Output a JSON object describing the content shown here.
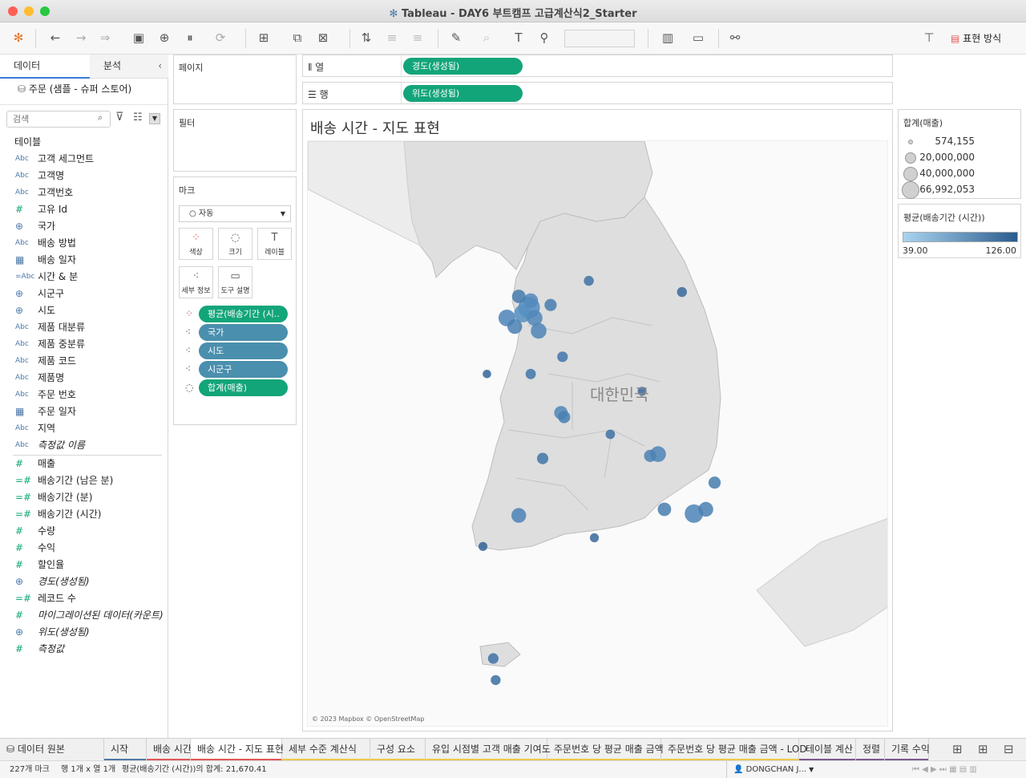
{
  "window": {
    "title": "Tableau - DAY6 부트캠프 고급계산식2_Starter"
  },
  "left_panel": {
    "tab_data": "데이터",
    "tab_analysis": "분석",
    "datasource": "주문 (샘플 - 슈퍼 스토어)",
    "search_placeholder": "검색",
    "tables_header": "테이블",
    "dimensions": [
      {
        "type": "Abc",
        "label": "고객 세그먼트"
      },
      {
        "type": "Abc",
        "label": "고객명"
      },
      {
        "type": "Abc",
        "label": "고객번호"
      },
      {
        "type": "#",
        "label": "고유 Id"
      },
      {
        "type": "geo",
        "label": "국가"
      },
      {
        "type": "Abc",
        "label": "배송 방법"
      },
      {
        "type": "date",
        "label": "배송 일자"
      },
      {
        "type": "=Abc",
        "label": "시간 & 분"
      },
      {
        "type": "geo",
        "label": "시군구"
      },
      {
        "type": "geo",
        "label": "시도"
      },
      {
        "type": "Abc",
        "label": "제품 대분류"
      },
      {
        "type": "Abc",
        "label": "제품 중분류"
      },
      {
        "type": "Abc",
        "label": "제품 코드"
      },
      {
        "type": "Abc",
        "label": "제품명"
      },
      {
        "type": "Abc",
        "label": "주문 번호"
      },
      {
        "type": "date",
        "label": "주문 일자"
      },
      {
        "type": "Abc",
        "label": "지역"
      },
      {
        "type": "Abc",
        "label": "측정값 이름",
        "italic": true
      }
    ],
    "measures": [
      {
        "type": "#",
        "label": "매출"
      },
      {
        "type": "=#",
        "label": "배송기간 (남은 분)"
      },
      {
        "type": "=#",
        "label": "배송기간 (분)"
      },
      {
        "type": "=#",
        "label": "배송기간 (시간)"
      },
      {
        "type": "#",
        "label": "수량"
      },
      {
        "type": "#",
        "label": "수익"
      },
      {
        "type": "#",
        "label": "할인율"
      },
      {
        "type": "geo",
        "label": "경도(생성됨)",
        "italic": true
      },
      {
        "type": "=#",
        "label": "레코드 수"
      },
      {
        "type": "#",
        "label": "마이그레이션된 데이터(카운트)",
        "italic": true
      },
      {
        "type": "geo",
        "label": "위도(생성됨)",
        "italic": true
      },
      {
        "type": "#",
        "label": "측정값",
        "italic": true
      }
    ]
  },
  "shelves": {
    "pages_label": "페이지",
    "filters_label": "필터",
    "marks_label": "마크",
    "mark_type": "자동",
    "mark_buttons": [
      "색상",
      "크기",
      "레이블",
      "세부 정보",
      "도구 설명"
    ],
    "mark_pills": [
      {
        "icon": "color",
        "label": "평균(배송기간 (시..",
        "color": "green"
      },
      {
        "icon": "detail",
        "label": "국가",
        "color": "blue"
      },
      {
        "icon": "detail",
        "label": "시도",
        "color": "blue"
      },
      {
        "icon": "detail",
        "label": "시군구",
        "color": "blue"
      },
      {
        "icon": "size",
        "label": "합계(매출)",
        "color": "green"
      }
    ],
    "columns_label": "열",
    "rows_label": "행",
    "columns_pill": "경도(생성됨)",
    "rows_pill": "위도(생성됨)"
  },
  "toolbar": {
    "show_me_label": "표현 방식"
  },
  "view": {
    "title": "배송 시간 - 지도 표현",
    "map_label": "대한민국",
    "attribution": "© 2023 Mapbox © OpenStreetMap"
  },
  "legends": {
    "size_title": "합계(매출)",
    "size_items": [
      "574,155",
      "20,000,000",
      "40,000,000",
      "66,992,053"
    ],
    "color_title": "평균(배송기간 (시간))",
    "color_min": "39.00",
    "color_max": "126.00",
    "color_low": "#a9d4ef",
    "color_high": "#2b5c8f"
  },
  "tabs": {
    "datasource_tab": "데이터 원본",
    "sheets": [
      {
        "label": "시작",
        "color": "#4e79a7"
      },
      {
        "label": "배송 시간",
        "color": "#e15759"
      },
      {
        "label": "배송 시간 - 지도 표현",
        "color": "#e15759",
        "active": true
      },
      {
        "label": "세부 수준 계산식",
        "color": "#edc948"
      },
      {
        "label": "구성 요소",
        "color": "#edc948"
      },
      {
        "label": "유입 시점별 고객 매출 기여도",
        "color": "#edc948"
      },
      {
        "label": "주문번호 당 평균 매출 금액",
        "color": "#edc948"
      },
      {
        "label": "주문번호 당 평균 매출 금액 - LOD",
        "color": "#edc948"
      },
      {
        "label": "테이블 계산",
        "color": "#7b5a8e"
      },
      {
        "label": "정렬",
        "color": "#7b5a8e"
      },
      {
        "label": "기록 수익",
        "color": "#7b5a8e"
      }
    ]
  },
  "status": {
    "marks": "227개 마크",
    "rows_cols": "행 1개 x 열 1개",
    "sum": "평균(배송기간 (시간))의 합계: 21,670.41",
    "user": "DONGCHAN J..."
  },
  "chart_data": {
    "type": "scatter",
    "title": "배송 시간 - 지도 표현",
    "size_measure": "합계(매출)",
    "color_measure": "평균(배송기간 (시간))",
    "color_range": [
      39.0,
      126.0
    ],
    "size_range": [
      574155,
      66992053
    ],
    "points_note_count": 227,
    "points": [
      {
        "lon": 126.98,
        "lat": 37.57,
        "size": 66992053,
        "color": 70
      },
      {
        "lon": 126.9,
        "lat": 37.5,
        "size": 40000000,
        "color": 65
      },
      {
        "lon": 127.05,
        "lat": 37.45,
        "size": 30000000,
        "color": 75
      },
      {
        "lon": 126.7,
        "lat": 37.45,
        "size": 35000000,
        "color": 80
      },
      {
        "lon": 127.1,
        "lat": 37.3,
        "size": 30000000,
        "color": 78
      },
      {
        "lon": 126.8,
        "lat": 37.35,
        "size": 25000000,
        "color": 85
      },
      {
        "lon": 127.0,
        "lat": 37.65,
        "size": 25000000,
        "color": 72
      },
      {
        "lon": 126.85,
        "lat": 37.7,
        "size": 20000000,
        "color": 90
      },
      {
        "lon": 127.25,
        "lat": 37.6,
        "size": 15000000,
        "color": 88
      },
      {
        "lon": 127.4,
        "lat": 37.0,
        "size": 10000000,
        "color": 95
      },
      {
        "lon": 129.05,
        "lat": 35.18,
        "size": 45000000,
        "color": 80
      },
      {
        "lon": 129.2,
        "lat": 35.23,
        "size": 25000000,
        "color": 85
      },
      {
        "lon": 128.6,
        "lat": 35.87,
        "size": 30000000,
        "color": 78
      },
      {
        "lon": 128.5,
        "lat": 35.85,
        "size": 15000000,
        "color": 82
      },
      {
        "lon": 127.38,
        "lat": 36.35,
        "size": 20000000,
        "color": 75
      },
      {
        "lon": 127.42,
        "lat": 36.3,
        "size": 15000000,
        "color": 85
      },
      {
        "lon": 126.85,
        "lat": 35.16,
        "size": 25000000,
        "color": 80
      },
      {
        "lon": 128.68,
        "lat": 35.23,
        "size": 20000000,
        "color": 88
      },
      {
        "lon": 129.31,
        "lat": 35.54,
        "size": 15000000,
        "color": 90
      },
      {
        "lon": 127.15,
        "lat": 35.82,
        "size": 12000000,
        "color": 95
      },
      {
        "lon": 126.53,
        "lat": 33.5,
        "size": 10000000,
        "color": 100
      },
      {
        "lon": 126.56,
        "lat": 33.25,
        "size": 8000000,
        "color": 105
      },
      {
        "lon": 128.9,
        "lat": 37.75,
        "size": 8000000,
        "color": 110
      },
      {
        "lon": 127.73,
        "lat": 37.88,
        "size": 8000000,
        "color": 100
      },
      {
        "lon": 128.4,
        "lat": 36.6,
        "size": 6000000,
        "color": 110
      },
      {
        "lon": 127.0,
        "lat": 36.8,
        "size": 9000000,
        "color": 95
      },
      {
        "lon": 126.45,
        "lat": 36.8,
        "size": 5000000,
        "color": 115
      },
      {
        "lon": 126.4,
        "lat": 34.8,
        "size": 6000000,
        "color": 118
      },
      {
        "lon": 128.0,
        "lat": 36.1,
        "size": 7000000,
        "color": 100
      },
      {
        "lon": 127.8,
        "lat": 34.9,
        "size": 6000000,
        "color": 112
      }
    ]
  }
}
